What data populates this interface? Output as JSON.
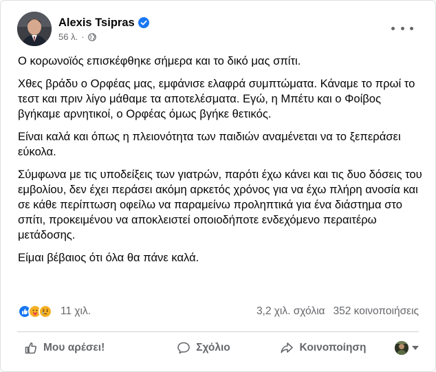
{
  "post": {
    "author": "Alexis Tsipras",
    "verified": true,
    "time": "56 λ.",
    "separator": "·",
    "privacy_icon": "globe-icon",
    "paragraphs": [
      "Ο κορωνοϊός επισκέφθηκε σήμερα και το δικό μας σπίτι.",
      "Χθες βράδυ ο Ορφέας μας, εμφάνισε ελαφρά συμπτώματα. Κάναμε το πρωί το τεστ και πριν λίγο μάθαμε τα αποτελέσματα. Εγώ, η Μπέτυ και ο Φοίβος βγήκαμε αρνητικοί, ο Ορφέας όμως βγήκε θετικός.",
      "Είναι καλά και όπως η πλειονότητα των παιδιών αναμένεται να το ξεπεράσει εύκολα.",
      "Σύμφωνα με τις υποδείξεις των γιατρών, παρότι έχω κάνει και τις δυο δόσεις του εμβολίου, δεν έχει περάσει ακόμη αρκετός χρόνος για να έχω πλήρη ανοσία και σε κάθε περίπτωση οφείλω να παραμείνω προληπτικά για ένα διάστημα στο σπίτι, προκειμένου να αποκλειστεί οποιοδήποτε ενδεχόμενο περαιτέρω μετάδοσης.",
      "Είμαι βέβαιος ότι όλα θα πάνε καλά."
    ]
  },
  "stats": {
    "reactions": [
      "like-reaction-icon",
      "care-reaction-icon",
      "sad-reaction-icon"
    ],
    "reaction_count": "11 χιλ.",
    "comments": "3,2 χιλ. σχόλια",
    "shares": "352 κοινοποιήσεις"
  },
  "actions": {
    "like": "Μου αρέσει!",
    "comment": "Σχόλιο",
    "share": "Κοινοποίηση"
  },
  "colors": {
    "text": "#050505",
    "secondary": "#65676b",
    "verified": "#1877f2",
    "like": "#1877f2",
    "divider": "#ced0d4"
  }
}
